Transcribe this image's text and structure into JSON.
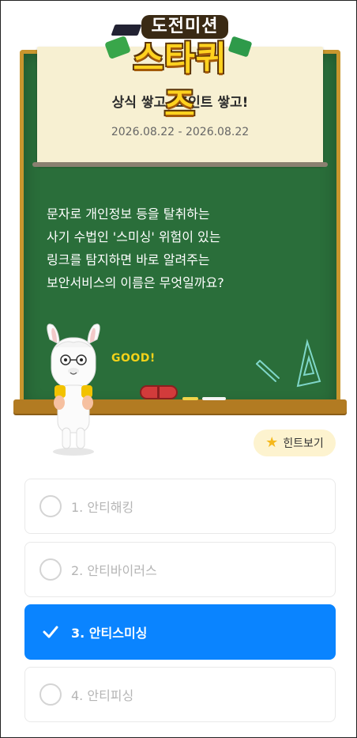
{
  "logo": {
    "top_text": "도전미션",
    "main_text": "스타퀴즈"
  },
  "mission": {
    "title": "상식 쌓고, 포인트 쌓고!",
    "date_range": "2026.08.22 - 2026.08.22"
  },
  "question": {
    "lines": [
      "문자로 개인정보 등을 탈취하는",
      "사기 수법인 '스미싱' 위험이 있는",
      "링크를 탐지하면 바로 알려주는",
      "보안서비스의 이름은 무엇일까요?"
    ]
  },
  "board_decor": {
    "good_text": "GOOD!"
  },
  "hint": {
    "label": "힌트보기",
    "icon": "star-icon"
  },
  "options": [
    {
      "label": "1. 안티해킹",
      "selected": false
    },
    {
      "label": "2. 안티바이러스",
      "selected": false
    },
    {
      "label": "3. 안티스미싱",
      "selected": true
    },
    {
      "label": "4. 안티피싱",
      "selected": false
    }
  ],
  "colors": {
    "board_green": "#2a6e3a",
    "frame_wood": "#c9962e",
    "selected_blue": "#0a84ff",
    "hint_bg": "#fdf3cf",
    "star_yellow": "#f5b81c"
  }
}
